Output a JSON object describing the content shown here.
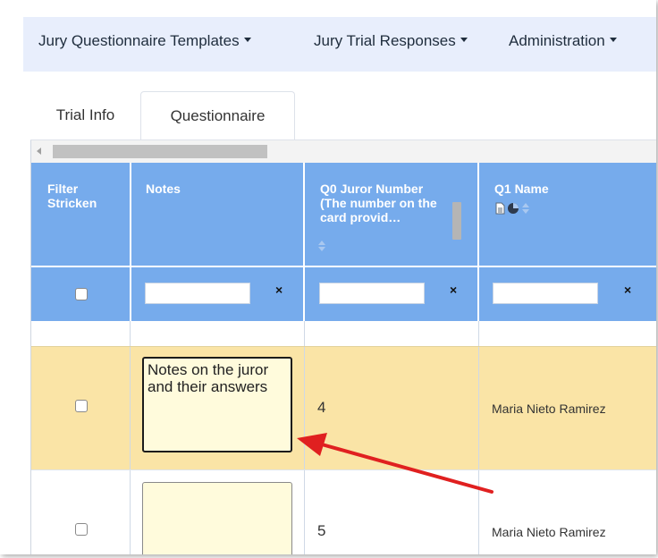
{
  "nav": {
    "items": [
      {
        "label": "Jury Questionnaire Templates"
      },
      {
        "label": "Jury Trial Responses"
      },
      {
        "label": "Administration"
      }
    ]
  },
  "tabs": [
    {
      "label": "Trial Info",
      "active": false
    },
    {
      "label": "Questionnaire",
      "active": true
    }
  ],
  "grid": {
    "headers": [
      {
        "label": "Filter Stricken"
      },
      {
        "label": "Notes"
      },
      {
        "label": "Q0 Juror Number (The number on the card provid…"
      },
      {
        "label": "Q1 Name"
      }
    ],
    "filters": {
      "clear_symbol": "×",
      "notes_value": "",
      "q0_value": "",
      "q1_value": ""
    },
    "rows": [
      {
        "stricken": false,
        "notes": "Notes on the juror and their answers",
        "q0": "4",
        "q1": "Maria Nieto Ramirez",
        "highlighted": true
      },
      {
        "stricken": false,
        "notes": "",
        "q0": "5",
        "q1": "Maria Nieto Ramirez",
        "highlighted": false
      }
    ]
  },
  "colors": {
    "header_bg": "#76abec",
    "navbar_bg": "#e8eefc",
    "highlight_row_bg": "#fae4a6",
    "notes_box_bg": "#fffbdc",
    "annotation_arrow": "#e02020"
  },
  "icons": {
    "dropdown": "caret-down-icon",
    "sort": "sort-updown-icon",
    "document": "document-icon",
    "pie_chart": "pie-chart-icon"
  }
}
